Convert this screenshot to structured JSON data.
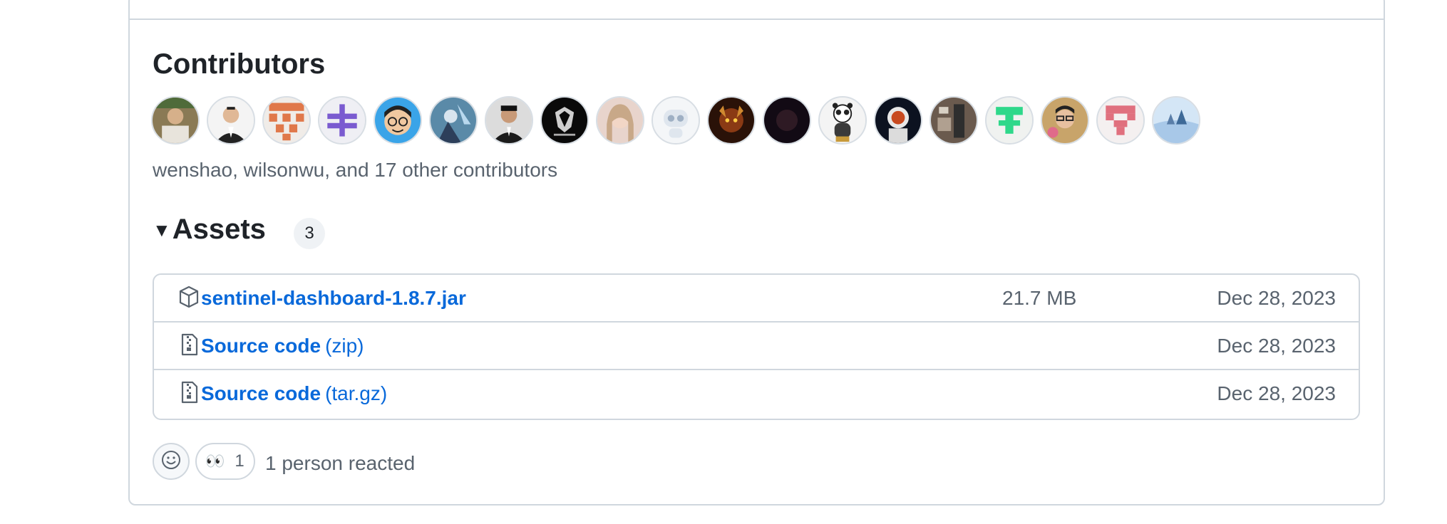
{
  "contributors": {
    "title": "Contributors",
    "summary": "wenshao, wilsonwu, and 17 other contributors",
    "avatars": [
      {
        "icon": "avatar-photo-person-outdoor"
      },
      {
        "icon": "avatar-photo-man-suit"
      },
      {
        "icon": "avatar-identicon-orange"
      },
      {
        "icon": "avatar-identicon-purple"
      },
      {
        "icon": "avatar-cartoon-glasses"
      },
      {
        "icon": "avatar-anime-art"
      },
      {
        "icon": "avatar-photo-man-dark-suit"
      },
      {
        "icon": "avatar-shield-logo"
      },
      {
        "icon": "avatar-photo-woman"
      },
      {
        "icon": "avatar-robot"
      },
      {
        "icon": "avatar-fantasy-art"
      },
      {
        "icon": "avatar-dark-portrait"
      },
      {
        "icon": "avatar-panda"
      },
      {
        "icon": "avatar-astronaut"
      },
      {
        "icon": "avatar-photo-brown"
      },
      {
        "icon": "avatar-identicon-green"
      },
      {
        "icon": "avatar-photo-person-glasses"
      },
      {
        "icon": "avatar-identicon-pink"
      },
      {
        "icon": "avatar-landscape-blue"
      }
    ]
  },
  "assets": {
    "title": "Assets",
    "count": "3",
    "rows": [
      {
        "icon": "package-icon",
        "name": "sentinel-dashboard-1.8.7.jar",
        "suffix": "",
        "size": "21.7 MB",
        "date": "Dec 28, 2023"
      },
      {
        "icon": "file-zip-icon",
        "name": "Source code",
        "suffix": "(zip)",
        "size": "",
        "date": "Dec 28, 2023"
      },
      {
        "icon": "file-zip-icon",
        "name": "Source code",
        "suffix": "(tar.gz)",
        "size": "",
        "date": "Dec 28, 2023"
      }
    ]
  },
  "reactions": {
    "emoji": "👀",
    "count": "1",
    "summary": "1 person reacted"
  },
  "colors": {
    "link": "#0969da",
    "muted": "#59636e",
    "border": "#d0d7de"
  }
}
